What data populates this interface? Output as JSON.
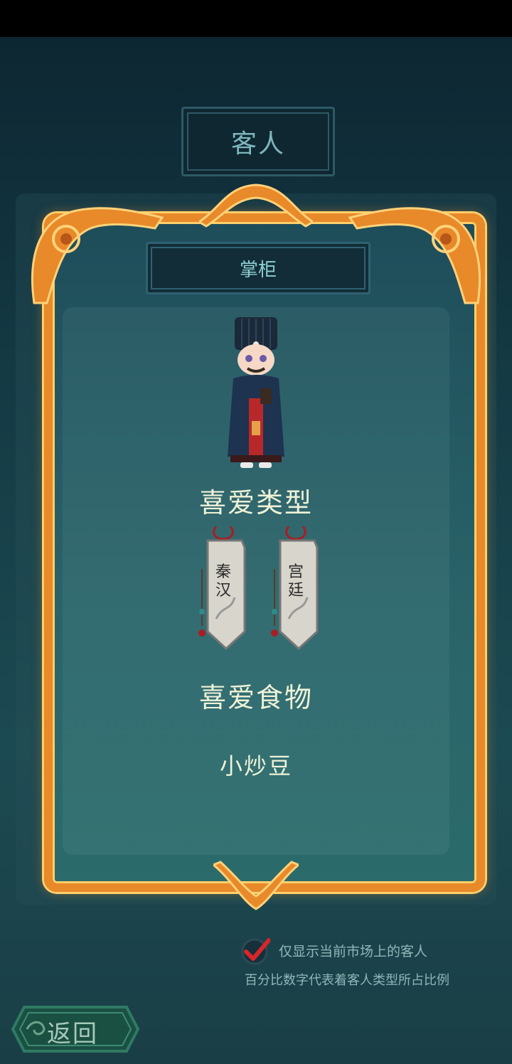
{
  "header": {
    "title": "客人"
  },
  "card": {
    "role": "掌柜",
    "favorite_types_heading": "喜爱类型",
    "favorite_types": [
      {
        "line1": "秦",
        "line2": "汉"
      },
      {
        "line1": "宫",
        "line2": "廷"
      }
    ],
    "favorite_food_heading": "喜爱食物",
    "favorite_food": "小炒豆"
  },
  "options": {
    "filter_label": "仅显示当前市场上的客人",
    "filter_checked": true,
    "note": "百分比数字代表着客人类型所占比例"
  },
  "footer": {
    "back_label": "返回"
  },
  "colors": {
    "frame": "#e8892a",
    "accent_text": "#8fcfd2",
    "check": "#d8262a"
  }
}
